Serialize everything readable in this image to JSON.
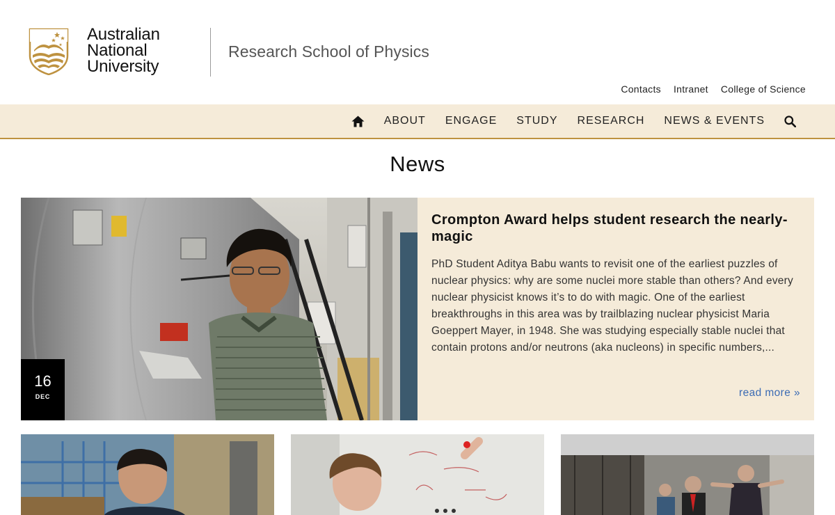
{
  "header": {
    "university_line1": "Australian",
    "university_line2": "National",
    "university_line3": "University",
    "school": "Research School of Physics",
    "utility_links": [
      "Contacts",
      "Intranet",
      "College of Science"
    ]
  },
  "nav": {
    "items": [
      "ABOUT",
      "ENGAGE",
      "STUDY",
      "RESEARCH",
      "NEWS & EVENTS"
    ],
    "icons": {
      "home": "home-icon",
      "search": "search-icon"
    }
  },
  "page": {
    "title": "News"
  },
  "featured": {
    "title": "Crompton Award helps student research the nearly-magic",
    "summary": "PhD Student Aditya Babu wants to revisit one of the earliest puzzles of nuclear physics: why are some nuclei more stable than others? And every nuclear physicist knows it’s to do with magic. One of the earliest breakthroughs in this area was by trailblazing nuclear physicist Maria Goeppert Mayer, in 1948. She was studying especially stable nuclei that contain protons and/or neutrons (aka nucleons) in specific numbers,...",
    "read_more": "read more »",
    "date_day": "16",
    "date_month": "DEC"
  },
  "colors": {
    "brand_gold": "#be9240",
    "nav_bg": "#f5ebd9",
    "link_blue": "#3c6cb4"
  }
}
